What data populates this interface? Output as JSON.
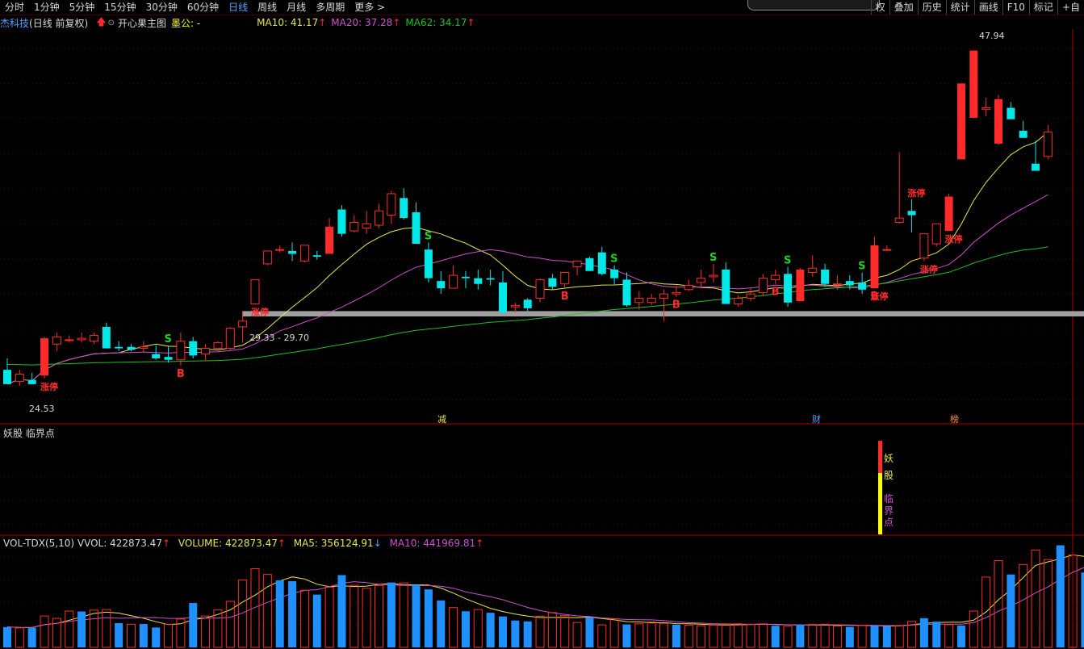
{
  "toolbar": {
    "periods": [
      {
        "label": "分时",
        "active": false
      },
      {
        "label": "1分钟",
        "active": false
      },
      {
        "label": "5分钟",
        "active": false
      },
      {
        "label": "15分钟",
        "active": false
      },
      {
        "label": "30分钟",
        "active": false
      },
      {
        "label": "60分钟",
        "active": false
      },
      {
        "label": "日线",
        "active": true
      },
      {
        "label": "周线",
        "active": false
      },
      {
        "label": "月线",
        "active": false
      },
      {
        "label": "多周期",
        "active": false
      },
      {
        "label": "更多 >",
        "active": false
      }
    ],
    "right": [
      "权",
      "叠加",
      "历史",
      "统计",
      "画线",
      "F10",
      "标记",
      "+自"
    ]
  },
  "main_info": {
    "stock": "杰科技",
    "mode": "(日线 前复权)",
    "formula": "开心果主图",
    "special": "墨公: -",
    "ma10": "MA10: 41.17",
    "ma20": "MA20: 37.28",
    "ma62": "MA62: 34.17"
  },
  "colors": {
    "up": "#ff2a2a",
    "down": "#00e8e8",
    "ma10": "#e8e84a",
    "ma20": "#d050d0",
    "ma62": "#20c020",
    "vol_bar": "#1e90ff",
    "background": "#000000"
  },
  "labels": {
    "high": "47.94",
    "low": "24.53",
    "band": "29.33 - 29.70",
    "limit_up": "涨停",
    "buy": "B",
    "sell": "S",
    "event1": "减",
    "event2": "财",
    "event3": "榜"
  },
  "indicator": {
    "title": "妖股 临界点",
    "chars": [
      "妖",
      "股",
      "临",
      "界",
      "点"
    ]
  },
  "volume_info": {
    "name": "VOL-TDX(5,10)",
    "vvol": "VVOL: 422873.47",
    "volume": "VOLUME: 422873.47",
    "ma5": "MA5: 356124.91",
    "ma10": "MA10: 441969.81"
  },
  "chart_data": {
    "type": "candlestick",
    "price_range": [
      22.0,
      49.4
    ],
    "candles": [
      {
        "o": 25.6,
        "h": 26.4,
        "l": 24.9,
        "c": 24.6
      },
      {
        "o": 24.8,
        "h": 25.6,
        "l": 24.5,
        "c": 25.3
      },
      {
        "o": 24.9,
        "h": 25.4,
        "l": 24.6,
        "c": 24.6
      },
      {
        "o": 25.2,
        "h": 27.9,
        "l": 25.0,
        "c": 27.8
      },
      {
        "o": 27.4,
        "h": 28.2,
        "l": 26.9,
        "c": 27.9
      },
      {
        "o": 27.7,
        "h": 28.0,
        "l": 27.5,
        "c": 27.7
      },
      {
        "o": 27.7,
        "h": 28.2,
        "l": 27.5,
        "c": 27.8
      },
      {
        "o": 27.6,
        "h": 28.2,
        "l": 27.4,
        "c": 28.0
      },
      {
        "o": 28.6,
        "h": 28.9,
        "l": 27.1,
        "c": 27.1
      },
      {
        "o": 27.2,
        "h": 27.6,
        "l": 26.9,
        "c": 27.1
      },
      {
        "o": 27.2,
        "h": 27.4,
        "l": 26.9,
        "c": 27.0
      },
      {
        "o": 27.1,
        "h": 27.6,
        "l": 26.8,
        "c": 27.2
      },
      {
        "o": 26.7,
        "h": 27.3,
        "l": 26.3,
        "c": 26.4
      },
      {
        "o": 26.5,
        "h": 27.3,
        "l": 26.1,
        "c": 26.3
      },
      {
        "o": 26.3,
        "h": 28.2,
        "l": 25.9,
        "c": 27.6
      },
      {
        "o": 27.6,
        "h": 27.9,
        "l": 26.4,
        "c": 26.6
      },
      {
        "o": 26.7,
        "h": 27.4,
        "l": 26.2,
        "c": 27.1
      },
      {
        "o": 27.1,
        "h": 27.6,
        "l": 26.9,
        "c": 27.5
      },
      {
        "o": 27.1,
        "h": 28.6,
        "l": 26.9,
        "c": 28.5
      },
      {
        "o": 28.6,
        "h": 29.7,
        "l": 27.5,
        "c": 29.0
      },
      {
        "o": 30.2,
        "h": 31.9,
        "l": 30.2,
        "c": 31.9
      },
      {
        "o": 33.0,
        "h": 33.9,
        "l": 32.9,
        "c": 33.9
      },
      {
        "o": 34.0,
        "h": 34.3,
        "l": 33.8,
        "c": 34.0
      },
      {
        "o": 33.9,
        "h": 34.5,
        "l": 33.2,
        "c": 33.7
      },
      {
        "o": 33.2,
        "h": 34.3,
        "l": 33.1,
        "c": 34.3
      },
      {
        "o": 33.6,
        "h": 33.9,
        "l": 33.3,
        "c": 33.5
      },
      {
        "o": 33.7,
        "h": 36.2,
        "l": 33.7,
        "c": 35.6
      },
      {
        "o": 36.8,
        "h": 37.1,
        "l": 34.9,
        "c": 35.1
      },
      {
        "o": 35.3,
        "h": 36.4,
        "l": 35.2,
        "c": 35.9
      },
      {
        "o": 35.5,
        "h": 36.7,
        "l": 35.1,
        "c": 35.8
      },
      {
        "o": 35.7,
        "h": 37.2,
        "l": 35.5,
        "c": 36.7
      },
      {
        "o": 36.4,
        "h": 38.1,
        "l": 35.8,
        "c": 37.9
      },
      {
        "o": 37.6,
        "h": 38.3,
        "l": 36.1,
        "c": 36.2
      },
      {
        "o": 36.6,
        "h": 37.3,
        "l": 34.4,
        "c": 34.4
      },
      {
        "o": 34.0,
        "h": 34.5,
        "l": 31.7,
        "c": 32.0
      },
      {
        "o": 31.8,
        "h": 32.5,
        "l": 30.9,
        "c": 31.3
      },
      {
        "o": 31.3,
        "h": 32.9,
        "l": 31.3,
        "c": 32.2
      },
      {
        "o": 32.1,
        "h": 32.5,
        "l": 31.3,
        "c": 32.0
      },
      {
        "o": 32.0,
        "h": 32.6,
        "l": 31.2,
        "c": 31.6
      },
      {
        "o": 32.0,
        "h": 32.6,
        "l": 31.5,
        "c": 31.9
      },
      {
        "o": 31.7,
        "h": 32.5,
        "l": 29.6,
        "c": 29.6
      },
      {
        "o": 30.0,
        "h": 30.3,
        "l": 29.6,
        "c": 30.1
      },
      {
        "o": 30.5,
        "h": 30.6,
        "l": 29.7,
        "c": 29.9
      },
      {
        "o": 30.6,
        "h": 32.0,
        "l": 30.3,
        "c": 31.9
      },
      {
        "o": 32.0,
        "h": 32.3,
        "l": 31.2,
        "c": 31.4
      },
      {
        "o": 31.6,
        "h": 32.3,
        "l": 31.3,
        "c": 32.4
      },
      {
        "o": 32.8,
        "h": 33.1,
        "l": 32.2,
        "c": 33.2
      },
      {
        "o": 33.4,
        "h": 33.5,
        "l": 32.5,
        "c": 32.5
      },
      {
        "o": 33.8,
        "h": 34.2,
        "l": 32.2,
        "c": 32.3
      },
      {
        "o": 32.6,
        "h": 32.9,
        "l": 31.5,
        "c": 32.0
      },
      {
        "o": 31.9,
        "h": 32.4,
        "l": 30.0,
        "c": 30.1
      },
      {
        "o": 30.3,
        "h": 31.1,
        "l": 29.8,
        "c": 30.6
      },
      {
        "o": 30.3,
        "h": 30.9,
        "l": 30.1,
        "c": 30.6
      },
      {
        "o": 30.6,
        "h": 31.2,
        "l": 29.0,
        "c": 30.9
      },
      {
        "o": 30.9,
        "h": 31.5,
        "l": 30.7,
        "c": 31.0
      },
      {
        "o": 31.2,
        "h": 31.9,
        "l": 31.1,
        "c": 31.5
      },
      {
        "o": 31.7,
        "h": 32.6,
        "l": 31.3,
        "c": 32.0
      },
      {
        "o": 32.1,
        "h": 33.0,
        "l": 31.7,
        "c": 32.2
      },
      {
        "o": 32.6,
        "h": 33.1,
        "l": 30.3,
        "c": 30.2
      },
      {
        "o": 30.2,
        "h": 30.8,
        "l": 30.0,
        "c": 30.6
      },
      {
        "o": 30.6,
        "h": 31.3,
        "l": 30.4,
        "c": 30.9
      },
      {
        "o": 31.0,
        "h": 32.3,
        "l": 30.8,
        "c": 32.0
      },
      {
        "o": 31.9,
        "h": 32.6,
        "l": 31.6,
        "c": 32.2
      },
      {
        "o": 32.3,
        "h": 32.8,
        "l": 30.0,
        "c": 30.3
      },
      {
        "o": 30.4,
        "h": 32.7,
        "l": 30.4,
        "c": 32.6
      },
      {
        "o": 32.4,
        "h": 33.6,
        "l": 32.1,
        "c": 32.7
      },
      {
        "o": 32.6,
        "h": 33.0,
        "l": 31.4,
        "c": 31.6
      },
      {
        "o": 31.6,
        "h": 32.2,
        "l": 31.2,
        "c": 31.6
      },
      {
        "o": 31.8,
        "h": 32.2,
        "l": 31.2,
        "c": 31.5
      },
      {
        "o": 31.7,
        "h": 32.4,
        "l": 30.9,
        "c": 31.2
      },
      {
        "o": 31.3,
        "h": 34.9,
        "l": 31.3,
        "c": 34.3
      },
      {
        "o": 34.0,
        "h": 34.3,
        "l": 34.0,
        "c": 34.0
      },
      {
        "o": 35.9,
        "h": 40.8,
        "l": 35.8,
        "c": 36.2
      },
      {
        "o": 36.7,
        "h": 37.5,
        "l": 35.2,
        "c": 36.4
      },
      {
        "o": 33.4,
        "h": 35.1,
        "l": 33.2,
        "c": 35.1
      },
      {
        "o": 34.4,
        "h": 35.8,
        "l": 34.2,
        "c": 35.8
      },
      {
        "o": 35.3,
        "h": 37.9,
        "l": 35.3,
        "c": 37.7
      },
      {
        "o": 40.3,
        "h": 45.6,
        "l": 40.3,
        "c": 45.6
      },
      {
        "o": 43.2,
        "h": 47.9,
        "l": 43.2,
        "c": 47.9
      },
      {
        "o": 43.8,
        "h": 44.6,
        "l": 43.3,
        "c": 43.9
      },
      {
        "o": 41.4,
        "h": 44.8,
        "l": 41.3,
        "c": 44.5
      },
      {
        "o": 43.9,
        "h": 44.3,
        "l": 43.1,
        "c": 43.1
      },
      {
        "o": 42.3,
        "h": 43.0,
        "l": 41.9,
        "c": 41.8
      },
      {
        "o": 40.0,
        "h": 41.6,
        "l": 39.6,
        "c": 39.5
      },
      {
        "o": 40.5,
        "h": 42.7,
        "l": 40.3,
        "c": 42.2
      }
    ],
    "volumes": [
      {
        "v": 9.4,
        "d": true
      },
      {
        "v": 9.0,
        "d": false
      },
      {
        "v": 9.1,
        "d": true
      },
      {
        "v": 14.5,
        "d": false
      },
      {
        "v": 13.4,
        "d": false
      },
      {
        "v": 16.8,
        "d": false
      },
      {
        "v": 16.6,
        "d": true
      },
      {
        "v": 17.2,
        "d": false
      },
      {
        "v": 17.5,
        "d": false
      },
      {
        "v": 11.2,
        "d": true
      },
      {
        "v": 10.7,
        "d": false
      },
      {
        "v": 10.8,
        "d": true
      },
      {
        "v": 9.2,
        "d": true
      },
      {
        "v": 10.7,
        "d": false
      },
      {
        "v": 13.1,
        "d": false
      },
      {
        "v": 20.5,
        "d": true
      },
      {
        "v": 14.5,
        "d": false
      },
      {
        "v": 17.3,
        "d": false
      },
      {
        "v": 21.3,
        "d": false
      },
      {
        "v": 31.2,
        "d": false
      },
      {
        "v": 36.4,
        "d": false
      },
      {
        "v": 33.7,
        "d": false
      },
      {
        "v": 31.0,
        "d": true
      },
      {
        "v": 30.6,
        "d": true
      },
      {
        "v": 26.4,
        "d": false
      },
      {
        "v": 24.4,
        "d": true
      },
      {
        "v": 27.8,
        "d": false
      },
      {
        "v": 33.4,
        "d": true
      },
      {
        "v": 28.7,
        "d": false
      },
      {
        "v": 27.3,
        "d": false
      },
      {
        "v": 28.6,
        "d": false
      },
      {
        "v": 30.0,
        "d": true
      },
      {
        "v": 29.8,
        "d": false
      },
      {
        "v": 28.9,
        "d": true
      },
      {
        "v": 26.8,
        "d": true
      },
      {
        "v": 21.7,
        "d": true
      },
      {
        "v": 18.4,
        "d": false
      },
      {
        "v": 16.7,
        "d": true
      },
      {
        "v": 17.5,
        "d": false
      },
      {
        "v": 16.0,
        "d": true
      },
      {
        "v": 14.3,
        "d": true
      },
      {
        "v": 12.4,
        "d": true
      },
      {
        "v": 12.0,
        "d": true
      },
      {
        "v": 14.4,
        "d": false
      },
      {
        "v": 16.1,
        "d": false
      },
      {
        "v": 14.7,
        "d": false
      },
      {
        "v": 11.5,
        "d": false
      },
      {
        "v": 13.9,
        "d": true
      },
      {
        "v": 10.4,
        "d": false
      },
      {
        "v": 13.2,
        "d": false
      },
      {
        "v": 10.6,
        "d": true
      },
      {
        "v": 10.9,
        "d": false
      },
      {
        "v": 11.7,
        "d": false
      },
      {
        "v": 11.1,
        "d": false
      },
      {
        "v": 10.5,
        "d": true
      },
      {
        "v": 10.2,
        "d": false
      },
      {
        "v": 10.0,
        "d": false
      },
      {
        "v": 10.3,
        "d": false
      },
      {
        "v": 10.8,
        "d": false
      },
      {
        "v": 10.9,
        "d": false
      },
      {
        "v": 10.6,
        "d": false
      },
      {
        "v": 10.9,
        "d": false
      },
      {
        "v": 10.0,
        "d": true
      },
      {
        "v": 9.8,
        "d": false
      },
      {
        "v": 10.4,
        "d": true
      },
      {
        "v": 10.6,
        "d": false
      },
      {
        "v": 10.7,
        "d": false
      },
      {
        "v": 9.9,
        "d": false
      },
      {
        "v": 9.5,
        "d": true
      },
      {
        "v": 10.2,
        "d": false
      },
      {
        "v": 10.0,
        "d": true
      },
      {
        "v": 9.8,
        "d": true
      },
      {
        "v": 10.1,
        "d": false
      },
      {
        "v": 12.0,
        "d": false
      },
      {
        "v": 13.5,
        "d": true
      },
      {
        "v": 11.9,
        "d": true
      },
      {
        "v": 10.5,
        "d": false
      },
      {
        "v": 10.1,
        "d": true
      },
      {
        "v": 16.8,
        "d": false
      },
      {
        "v": 32.5,
        "d": false
      },
      {
        "v": 40.1,
        "d": false
      },
      {
        "v": 33.7,
        "d": true
      },
      {
        "v": 38.3,
        "d": false
      },
      {
        "v": 45.0,
        "d": false
      },
      {
        "v": 40.6,
        "d": false
      },
      {
        "v": 47.2,
        "d": true
      },
      {
        "v": 42.7,
        "d": false
      },
      {
        "v": 34.6,
        "d": true
      },
      {
        "v": 36.5,
        "d": true
      },
      {
        "v": 32.3,
        "d": true
      },
      {
        "v": 34.0,
        "d": false
      }
    ],
    "volume_range": [
      0,
      50
    ],
    "markers": [
      {
        "i": 3,
        "text": "涨停",
        "pos": "below"
      },
      {
        "i": 20,
        "text": "涨停",
        "pos": "below"
      },
      {
        "i": 70,
        "text": "涨停",
        "pos": "below"
      },
      {
        "i": 73,
        "text": "涨停",
        "pos": "above"
      },
      {
        "i": 74,
        "text": "涨停",
        "pos": "below"
      },
      {
        "i": 76,
        "text": "涨停",
        "pos": "below"
      },
      {
        "i": 14,
        "text": "B",
        "pos": "below"
      },
      {
        "i": 45,
        "text": "B",
        "pos": "below"
      },
      {
        "i": 54,
        "text": "B",
        "pos": "below"
      },
      {
        "i": 62,
        "text": "B",
        "pos": "below"
      },
      {
        "i": 70,
        "text": "B",
        "pos": "below"
      },
      {
        "i": 13,
        "text": "S",
        "pos": "above"
      },
      {
        "i": 34,
        "text": "S",
        "pos": "above"
      },
      {
        "i": 49,
        "text": "S",
        "pos": "above"
      },
      {
        "i": 57,
        "text": "S",
        "pos": "above"
      },
      {
        "i": 63,
        "text": "S",
        "pos": "above"
      },
      {
        "i": 69,
        "text": "S",
        "pos": "above"
      }
    ]
  }
}
